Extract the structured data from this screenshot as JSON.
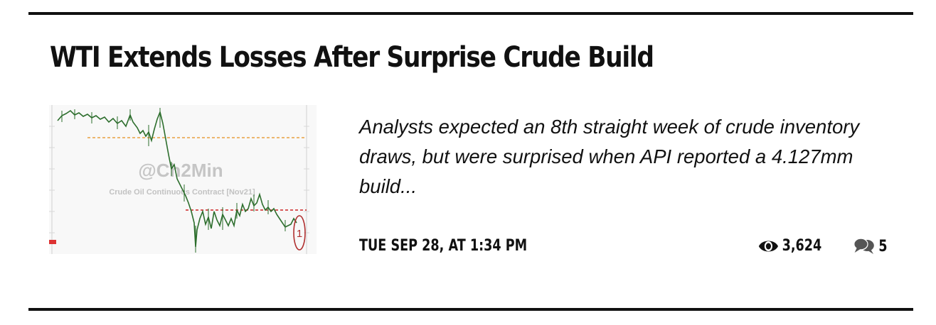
{
  "article": {
    "title": "WTI Extends Losses After Surprise Crude Build",
    "excerpt": "Analysts expected an 8th straight week of crude inventory draws, but were surprised when API reported a 4.127mm build...",
    "date": "TUE SEP 28, AT 1:34 PM",
    "views": "3,624",
    "comments": "5"
  },
  "thumbnail": {
    "watermark": "@Ch2Min",
    "subtitle": "Crude Oil Continuous Contract [Nov21]",
    "marker": "1"
  },
  "icons": {
    "views": "eye-icon",
    "comments": "comments-icon"
  },
  "colors": {
    "text": "#111111",
    "rule": "#111111",
    "orange_line": "#e8a040",
    "red_line": "#cc2222",
    "candles": "#2d6e2d"
  }
}
